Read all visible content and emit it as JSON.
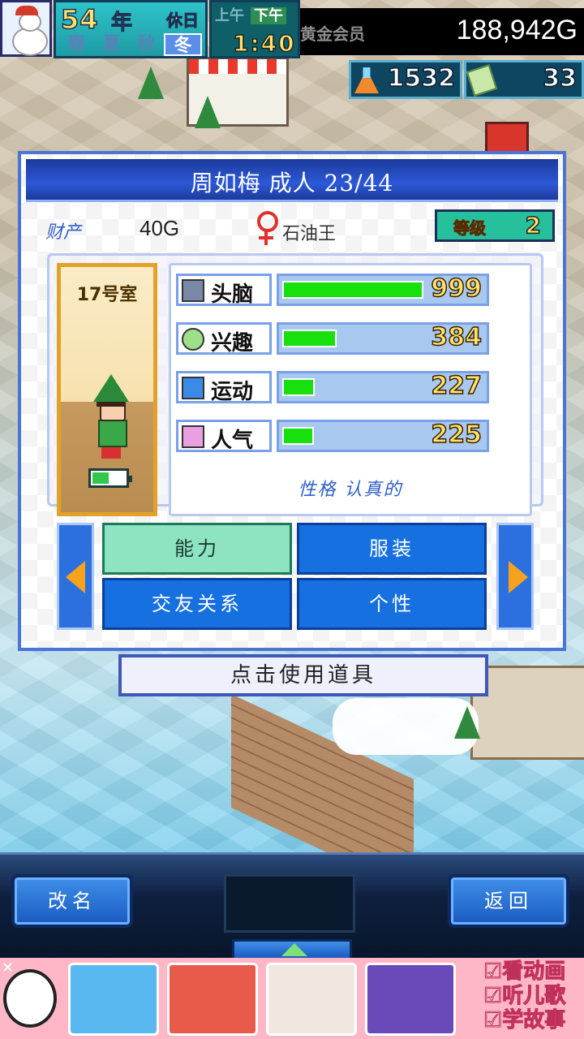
{
  "hud": {
    "year_number": "54",
    "year_label": "年",
    "holiday_label": "休日",
    "seasons": [
      "春",
      "夏",
      "秋",
      "冬"
    ],
    "active_season": 3,
    "am_label": "上午",
    "pm_label": "下午",
    "time": "1:40",
    "member_label": "黄金会员",
    "gold": "188,942G",
    "research_points": "1532",
    "tickets": "33"
  },
  "dialog": {
    "title": "周如梅 成人 23/44",
    "assets_label": "财产",
    "assets_value": "40G",
    "gender_icon": "female-symbol",
    "job": "石油王",
    "level_label": "等级",
    "level_value": "2",
    "room_label": "17号室",
    "stats": [
      {
        "icon": "brain-icon",
        "label": "头脑",
        "value": 999,
        "max": 999
      },
      {
        "icon": "interest-icon",
        "label": "兴趣",
        "value": 384,
        "max": 999
      },
      {
        "icon": "sports-icon",
        "label": "运动",
        "value": 227,
        "max": 999
      },
      {
        "icon": "popularity-icon",
        "label": "人气",
        "value": 225,
        "max": 999
      }
    ],
    "personality": "性格 认真的",
    "tabs": {
      "ability": "能力",
      "clothing": "服装",
      "friends": "交友关系",
      "individuality": "个性"
    }
  },
  "use_item_label": "点击使用道具",
  "bottom": {
    "rename_label": "改名",
    "back_label": "返回"
  },
  "ad": {
    "close": "✕",
    "list": [
      "☑看动画",
      "☑听儿歌",
      "☑学故事"
    ]
  },
  "colors": {
    "stat_fill": "#17e00c",
    "accent_blue": "#2c70e0",
    "active_tab": "#8ee3c0",
    "value_yellow": "#ffe36b"
  }
}
